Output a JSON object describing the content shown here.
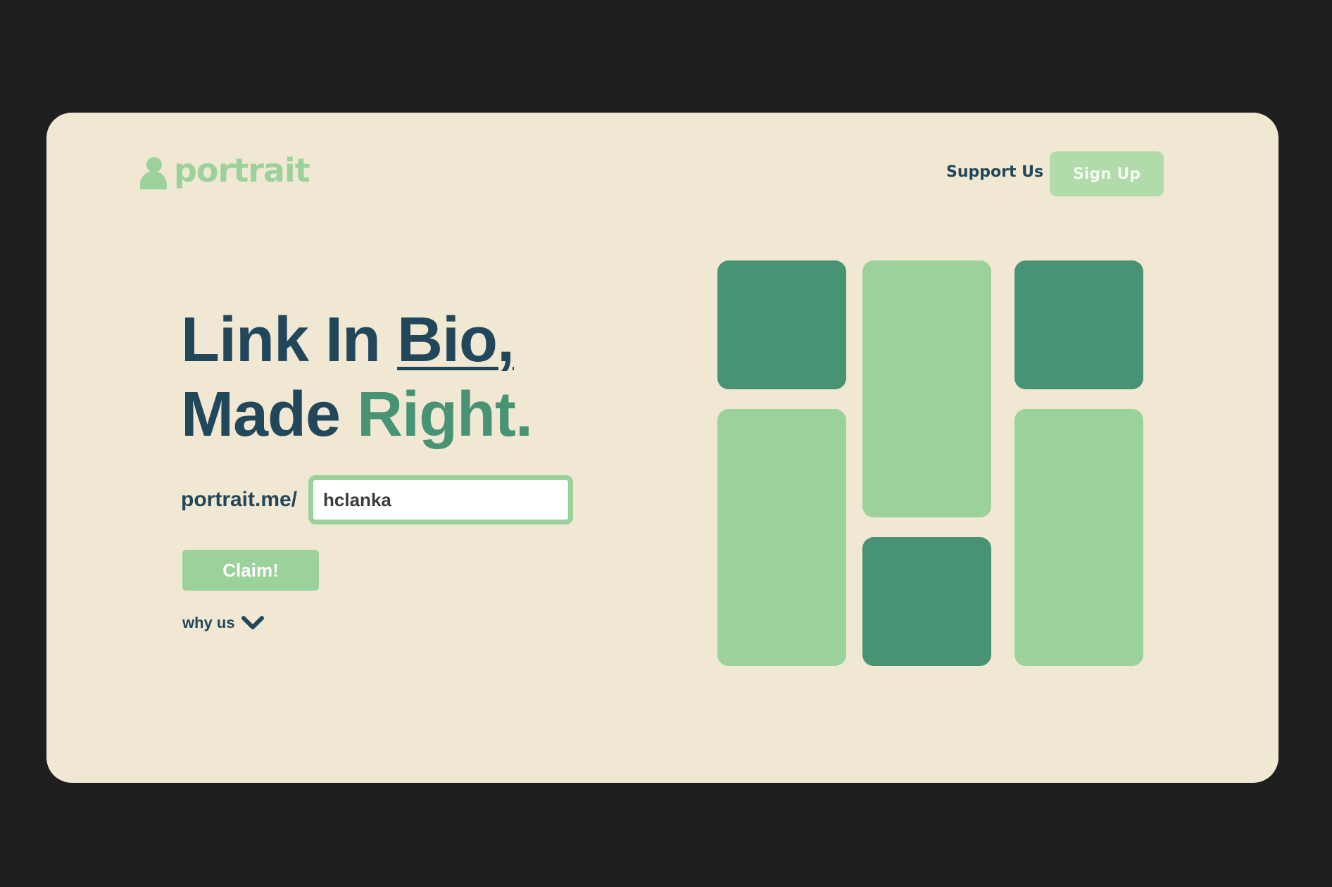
{
  "colors": {
    "background": "#1f1f1f",
    "card": "#f1e8d4",
    "navy": "#22475a",
    "green_light": "#9bd29c",
    "green_dark": "#489373",
    "signup_bg": "#b1dbaa"
  },
  "header": {
    "logo_icon": "person-icon",
    "logo_text": "portrait",
    "nav_link": "Support Us",
    "signup_label": "Sign Up"
  },
  "hero": {
    "headline_line1_a": "Link In ",
    "headline_line1_b": "Bio,",
    "headline_line2_a": "Made ",
    "headline_line2_b": "Right.",
    "url_prefix": "portrait.me/",
    "handle_value": "hclanka",
    "claim_label": "Claim!",
    "why_us_label": "why us",
    "why_us_icon": "chevron-down-icon"
  },
  "tiles": [
    {
      "tone": "dark"
    },
    {
      "tone": "light"
    },
    {
      "tone": "dark"
    },
    {
      "tone": "light"
    },
    {
      "tone": "dark"
    },
    {
      "tone": "light"
    }
  ]
}
